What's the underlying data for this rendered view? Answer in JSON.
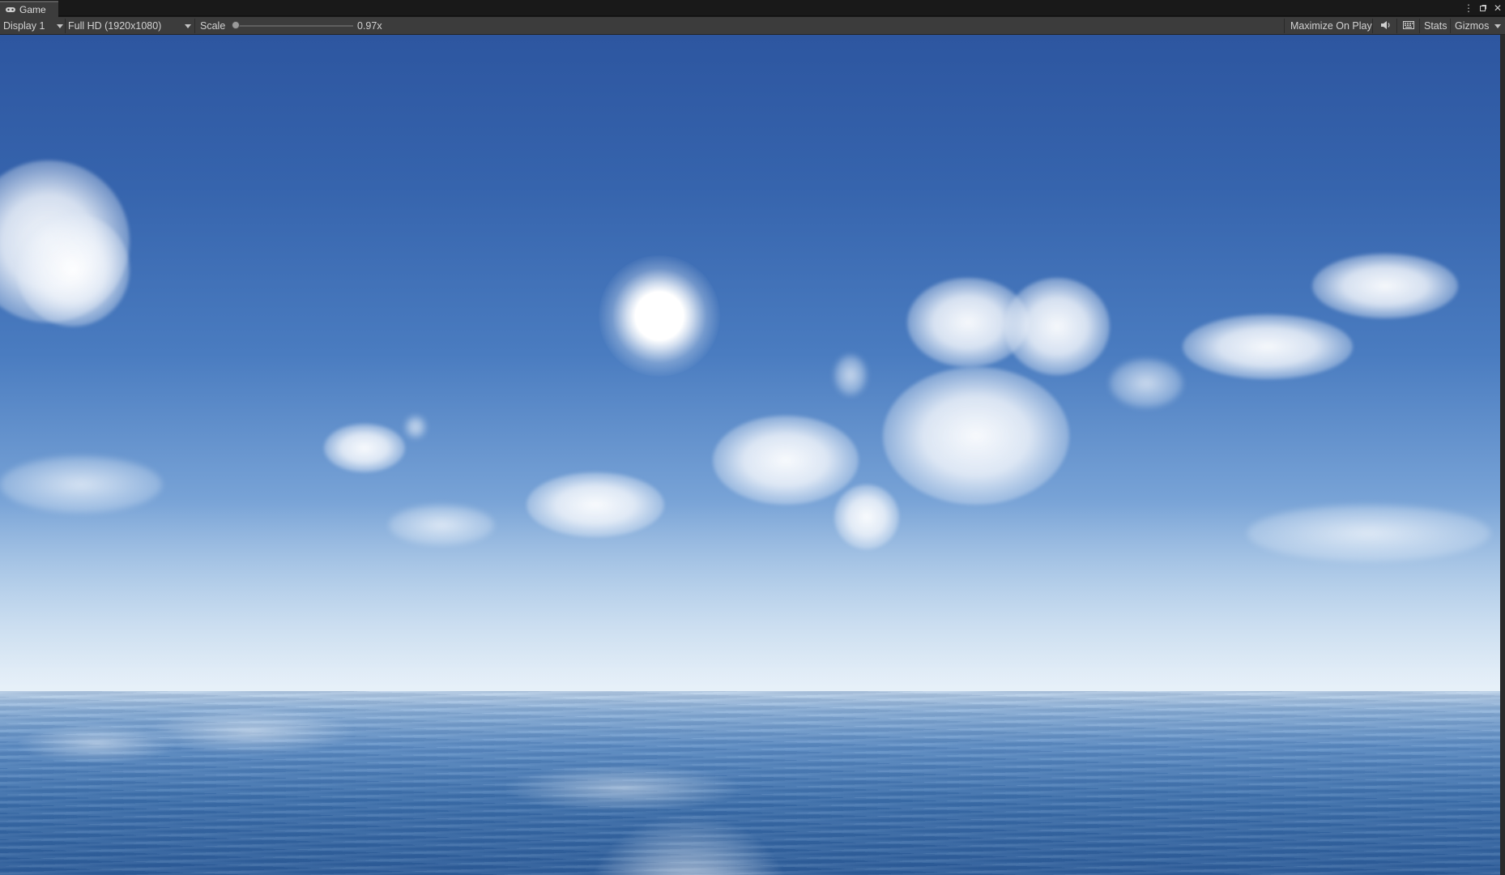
{
  "window": {
    "tab_label": "Game",
    "tab_icon": "gamepad-icon",
    "controls": [
      "more-options-icon",
      "maximize-window-icon",
      "close-icon"
    ]
  },
  "toolbar": {
    "display_label": "Display 1",
    "resolution_label": "Full HD (1920x1080)",
    "scale_label": "Scale",
    "scale_value": "0.97x",
    "maximize_label": "Maximize On Play",
    "audio_icon": "speaker-icon",
    "keyboard_icon": "keyboard-icon",
    "stats_label": "Stats",
    "gizmos_label": "Gizmos"
  },
  "scene": {
    "description_items": [
      "sky",
      "sun",
      "clouds",
      "ocean"
    ]
  }
}
